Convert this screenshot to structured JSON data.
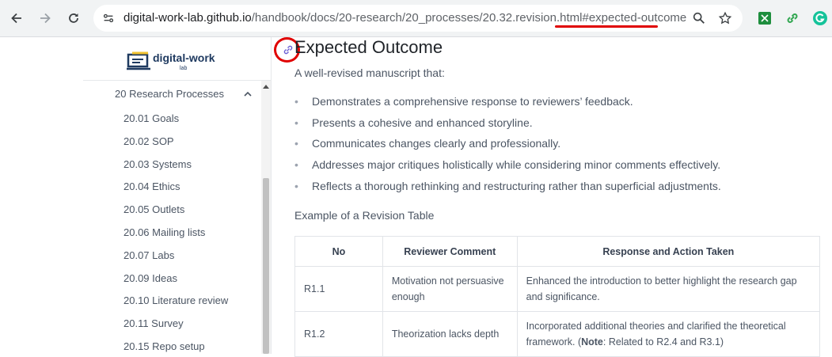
{
  "browser": {
    "url_host": "digital-work-lab.github.io",
    "url_path": "/handbook/docs/20-research/20_processes/20.32.revision.html",
    "url_fragment": "#expected-outcome",
    "icons": [
      "back-icon",
      "forward-icon",
      "reload-icon",
      "site-settings-icon",
      "zoom-icon",
      "bookmark-star-icon",
      "extension-icon",
      "link-extension-icon",
      "grammarly-icon"
    ]
  },
  "sidebar": {
    "logo_text": "digital-work",
    "logo_sub": "lab",
    "section": "20 Research Processes",
    "items": [
      {
        "label": "20.01 Goals"
      },
      {
        "label": "20.02 SOP"
      },
      {
        "label": "20.03 Systems"
      },
      {
        "label": "20.04 Ethics"
      },
      {
        "label": "20.05 Outlets"
      },
      {
        "label": "20.06 Mailing lists"
      },
      {
        "label": "20.07 Labs"
      },
      {
        "label": "20.09 Ideas"
      },
      {
        "label": "20.10 Literature review"
      },
      {
        "label": "20.11 Survey"
      },
      {
        "label": "20.15 Repo setup"
      }
    ]
  },
  "content": {
    "heading": "Expected Outcome",
    "intro": "A well-revised manuscript that:",
    "bullets": [
      "Demonstrates a comprehensive response to reviewers’ feedback.",
      "Presents a cohesive and enhanced storyline.",
      "Communicates changes clearly and professionally.",
      "Addresses major critiques holistically while considering minor comments effectively.",
      "Reflects a thorough rethinking and restructuring rather than superficial adjustments."
    ],
    "example_label": "Example of a Revision Table",
    "table": {
      "headers": [
        "No",
        "Reviewer Comment",
        "Response and Action Taken"
      ],
      "rows": [
        {
          "no": "R1.1",
          "comment": "Motivation not persuasive enough",
          "response": "Enhanced the introduction to better highlight the research gap and significance."
        },
        {
          "no": "R1.2",
          "comment": "Theorization lacks depth",
          "response_pre": "Incorporated additional theories and clarified the theoretical framework. (",
          "response_bold": "Note",
          "response_post": ": Related to R2.4 and R3.1)"
        }
      ]
    }
  },
  "colors": {
    "highlight": "#e00000",
    "toolbar": "#f1f3f4",
    "logo": "#1f3a60"
  }
}
